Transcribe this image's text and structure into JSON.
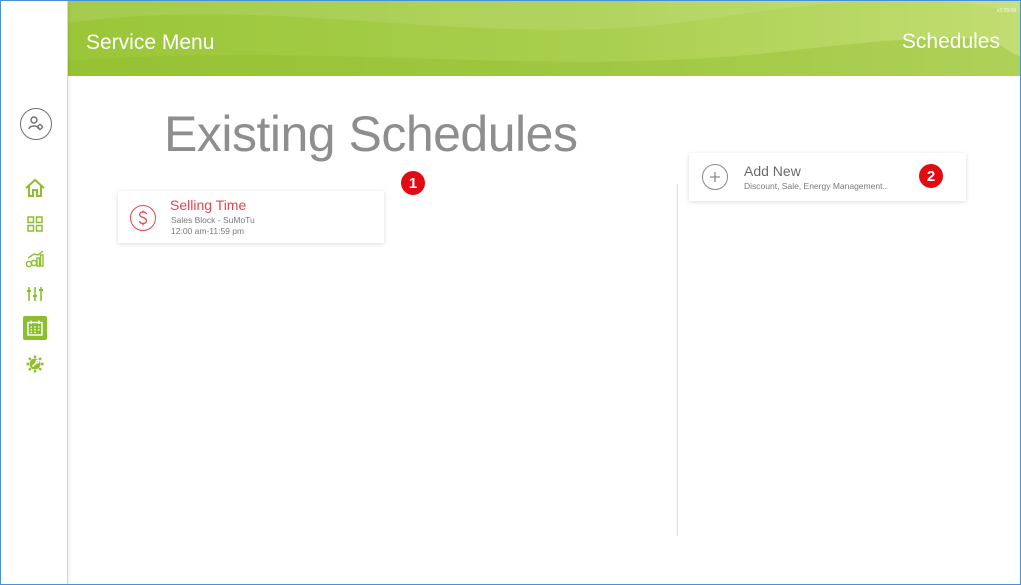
{
  "header": {
    "title": "Service Menu",
    "section": "Schedules",
    "version": "v2.09.09"
  },
  "sidebar": {
    "user_icon": "user-gear-icon",
    "items": [
      {
        "name": "home",
        "icon": "home-icon",
        "active": false
      },
      {
        "name": "dashboard",
        "icon": "grid-icon",
        "active": false
      },
      {
        "name": "reports",
        "icon": "chart-icon",
        "active": false
      },
      {
        "name": "settings",
        "icon": "sliders-icon",
        "active": false
      },
      {
        "name": "schedules",
        "icon": "calendar-icon",
        "active": true
      },
      {
        "name": "service",
        "icon": "gear-wrench-icon",
        "active": false
      }
    ]
  },
  "main": {
    "title": "Existing Schedules",
    "schedules": [
      {
        "title": "Selling Time",
        "subtitle": "Sales Block - SuMoTu",
        "time": "12:00 am-11:59 pm",
        "icon": "dollar-icon"
      }
    ],
    "add_new": {
      "title": "Add New",
      "subtitle": "Discount, Sale, Energy Management..",
      "icon": "plus-icon"
    },
    "annotations": [
      "1",
      "2"
    ]
  },
  "colors": {
    "accent_green": "#8dbe2d",
    "header_green": "#9cc83a",
    "schedule_red": "#e0484d",
    "badge_red": "#e20b12"
  }
}
